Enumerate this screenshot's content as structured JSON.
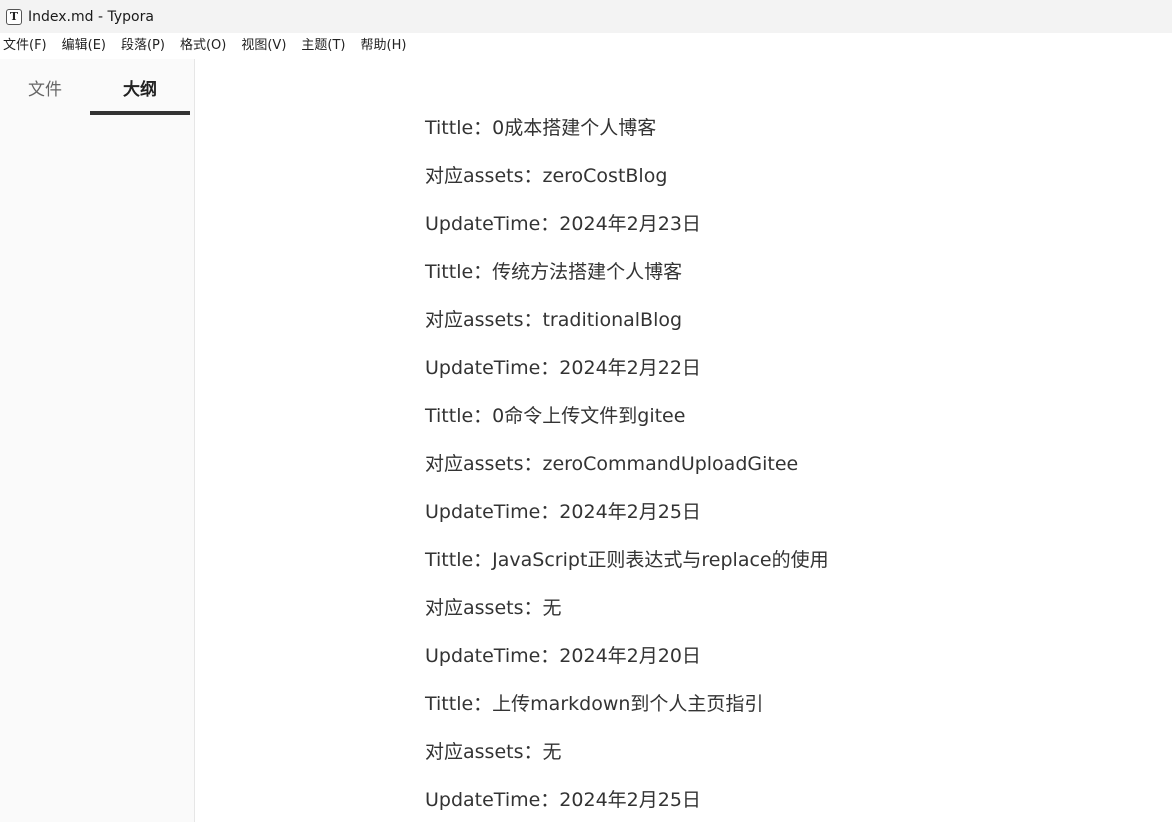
{
  "window": {
    "app_icon": "T",
    "title": "Index.md - Typora"
  },
  "menubar": {
    "items": [
      "文件(F)",
      "编辑(E)",
      "段落(P)",
      "格式(O)",
      "视图(V)",
      "主题(T)",
      "帮助(H)"
    ]
  },
  "sidebar": {
    "tabs": [
      {
        "label": "文件",
        "active": false
      },
      {
        "label": "大纲",
        "active": true
      }
    ]
  },
  "document": {
    "paragraphs": [
      "Tittle：0成本搭建个人博客",
      "对应assets：zeroCostBlog",
      "UpdateTime：2024年2月23日",
      "Tittle：传统方法搭建个人博客",
      "对应assets：traditionalBlog",
      "UpdateTime：2024年2月22日",
      "Tittle：0命令上传文件到gitee",
      "对应assets：zeroCommandUploadGitee",
      "UpdateTime：2024年2月25日",
      "Tittle：JavaScript正则表达式与replace的使用",
      "对应assets：无",
      "UpdateTime：2024年2月20日",
      "Tittle：上传markdown到个人主页指引",
      "对应assets：无",
      "UpdateTime：2024年2月25日"
    ]
  },
  "colors": {
    "titlebar_bg": "#f3f3f3",
    "sidebar_bg": "#fafafa",
    "text": "#333333",
    "active_tab_indicator": "#333333"
  }
}
